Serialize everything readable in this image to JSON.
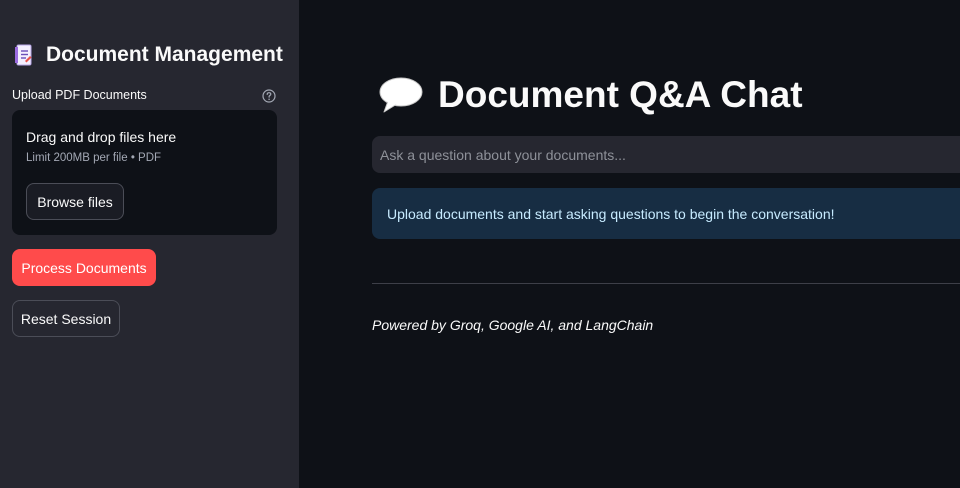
{
  "sidebar": {
    "title": "Document Management",
    "title_icon": "document-icon",
    "uploader": {
      "label": "Upload PDF Documents",
      "help_icon": "question-circle-icon",
      "drop_title": "Drag and drop files here",
      "drop_limit": "Limit 200MB per file • PDF",
      "browse_label": "Browse files"
    },
    "process_label": "Process Documents",
    "reset_label": "Reset Session"
  },
  "main": {
    "title": "Document Q&A Chat",
    "title_icon": "speech-bubble-icon",
    "input_placeholder": "Ask a question about your documents...",
    "input_value": "",
    "info_message": "Upload documents and start asking questions to begin the conversation!",
    "footer": "Powered by Groq, Google AI, and LangChain"
  },
  "colors": {
    "sidebar_bg": "#262730",
    "main_bg": "#0e1117",
    "primary": "#ff4b4b",
    "info_bg": "#172d43",
    "info_text": "#c7ebff"
  }
}
